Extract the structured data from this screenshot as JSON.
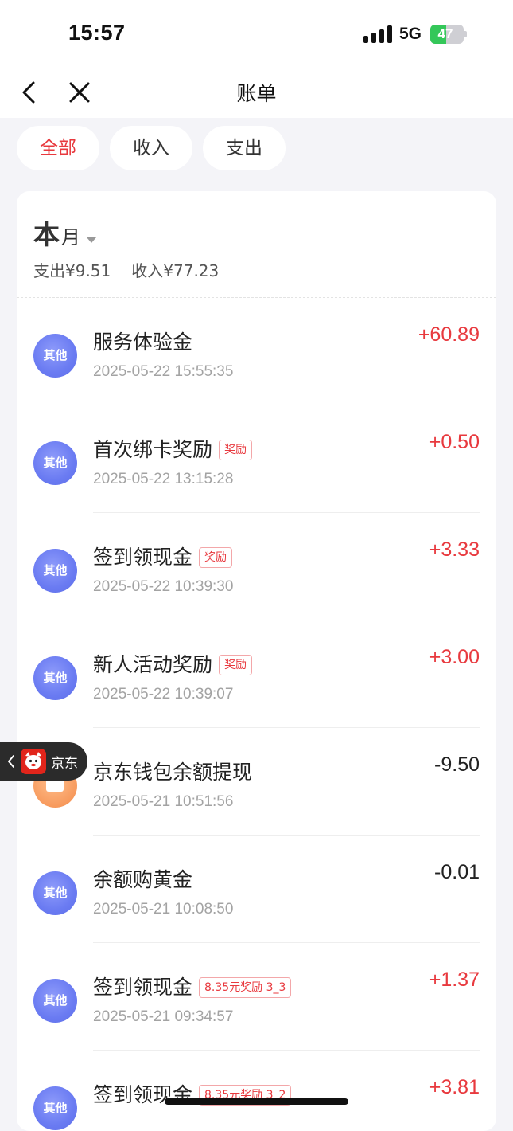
{
  "status_bar": {
    "time": "15:57",
    "network": "5G",
    "battery_percent": "47",
    "battery_level": 0.47
  },
  "nav": {
    "title": "账单"
  },
  "filters": [
    {
      "label": "全部",
      "active": true
    },
    {
      "label": "收入",
      "active": false
    },
    {
      "label": "支出",
      "active": false
    }
  ],
  "period": {
    "big": "本",
    "small": "月"
  },
  "summary": {
    "expense": "支出¥9.51",
    "income": "收入¥77.23"
  },
  "transactions": [
    {
      "avatar": "其他",
      "title": "服务体验金",
      "tag": "",
      "time": "2025-05-22 15:55:35",
      "amount": "+60.89",
      "sign": "pos"
    },
    {
      "avatar": "其他",
      "title": "首次绑卡奖励",
      "tag": "奖励",
      "time": "2025-05-22 13:15:28",
      "amount": "+0.50",
      "sign": "pos"
    },
    {
      "avatar": "其他",
      "title": "签到领现金",
      "tag": "奖励",
      "time": "2025-05-22 10:39:30",
      "amount": "+3.33",
      "sign": "pos"
    },
    {
      "avatar": "其他",
      "title": "新人活动奖励",
      "tag": "奖励",
      "time": "2025-05-22 10:39:07",
      "amount": "+3.00",
      "sign": "pos"
    },
    {
      "avatar": "",
      "title": "京东钱包余额提现",
      "tag": "",
      "time": "2025-05-21 10:51:56",
      "amount": "-9.50",
      "sign": "neg"
    },
    {
      "avatar": "其他",
      "title": "余额购黄金",
      "tag": "",
      "time": "2025-05-21 10:08:50",
      "amount": "-0.01",
      "sign": "neg"
    },
    {
      "avatar": "其他",
      "title": "签到领现金",
      "tag": "8.35元奖励 3_3",
      "time": "2025-05-21 09:34:57",
      "amount": "+1.37",
      "sign": "pos"
    },
    {
      "avatar": "其他",
      "title": "签到领现金",
      "tag": "8.35元奖励 3_2",
      "time": "",
      "amount": "+3.81",
      "sign": "pos"
    }
  ],
  "floating_badge": {
    "label": "京东"
  },
  "colors": {
    "accent": "#e8393e",
    "avatar_blue": "#6a7bf2",
    "avatar_orange": "#f79a5d"
  }
}
